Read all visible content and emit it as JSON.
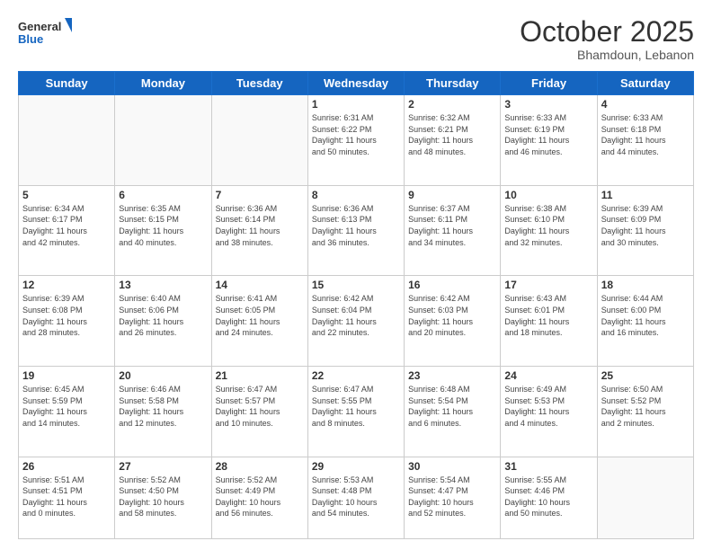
{
  "header": {
    "logo_general": "General",
    "logo_blue": "Blue",
    "month": "October 2025",
    "location": "Bhamdoun, Lebanon"
  },
  "days_of_week": [
    "Sunday",
    "Monday",
    "Tuesday",
    "Wednesday",
    "Thursday",
    "Friday",
    "Saturday"
  ],
  "weeks": [
    [
      {
        "num": "",
        "info": ""
      },
      {
        "num": "",
        "info": ""
      },
      {
        "num": "",
        "info": ""
      },
      {
        "num": "1",
        "info": "Sunrise: 6:31 AM\nSunset: 6:22 PM\nDaylight: 11 hours\nand 50 minutes."
      },
      {
        "num": "2",
        "info": "Sunrise: 6:32 AM\nSunset: 6:21 PM\nDaylight: 11 hours\nand 48 minutes."
      },
      {
        "num": "3",
        "info": "Sunrise: 6:33 AM\nSunset: 6:19 PM\nDaylight: 11 hours\nand 46 minutes."
      },
      {
        "num": "4",
        "info": "Sunrise: 6:33 AM\nSunset: 6:18 PM\nDaylight: 11 hours\nand 44 minutes."
      }
    ],
    [
      {
        "num": "5",
        "info": "Sunrise: 6:34 AM\nSunset: 6:17 PM\nDaylight: 11 hours\nand 42 minutes."
      },
      {
        "num": "6",
        "info": "Sunrise: 6:35 AM\nSunset: 6:15 PM\nDaylight: 11 hours\nand 40 minutes."
      },
      {
        "num": "7",
        "info": "Sunrise: 6:36 AM\nSunset: 6:14 PM\nDaylight: 11 hours\nand 38 minutes."
      },
      {
        "num": "8",
        "info": "Sunrise: 6:36 AM\nSunset: 6:13 PM\nDaylight: 11 hours\nand 36 minutes."
      },
      {
        "num": "9",
        "info": "Sunrise: 6:37 AM\nSunset: 6:11 PM\nDaylight: 11 hours\nand 34 minutes."
      },
      {
        "num": "10",
        "info": "Sunrise: 6:38 AM\nSunset: 6:10 PM\nDaylight: 11 hours\nand 32 minutes."
      },
      {
        "num": "11",
        "info": "Sunrise: 6:39 AM\nSunset: 6:09 PM\nDaylight: 11 hours\nand 30 minutes."
      }
    ],
    [
      {
        "num": "12",
        "info": "Sunrise: 6:39 AM\nSunset: 6:08 PM\nDaylight: 11 hours\nand 28 minutes."
      },
      {
        "num": "13",
        "info": "Sunrise: 6:40 AM\nSunset: 6:06 PM\nDaylight: 11 hours\nand 26 minutes."
      },
      {
        "num": "14",
        "info": "Sunrise: 6:41 AM\nSunset: 6:05 PM\nDaylight: 11 hours\nand 24 minutes."
      },
      {
        "num": "15",
        "info": "Sunrise: 6:42 AM\nSunset: 6:04 PM\nDaylight: 11 hours\nand 22 minutes."
      },
      {
        "num": "16",
        "info": "Sunrise: 6:42 AM\nSunset: 6:03 PM\nDaylight: 11 hours\nand 20 minutes."
      },
      {
        "num": "17",
        "info": "Sunrise: 6:43 AM\nSunset: 6:01 PM\nDaylight: 11 hours\nand 18 minutes."
      },
      {
        "num": "18",
        "info": "Sunrise: 6:44 AM\nSunset: 6:00 PM\nDaylight: 11 hours\nand 16 minutes."
      }
    ],
    [
      {
        "num": "19",
        "info": "Sunrise: 6:45 AM\nSunset: 5:59 PM\nDaylight: 11 hours\nand 14 minutes."
      },
      {
        "num": "20",
        "info": "Sunrise: 6:46 AM\nSunset: 5:58 PM\nDaylight: 11 hours\nand 12 minutes."
      },
      {
        "num": "21",
        "info": "Sunrise: 6:47 AM\nSunset: 5:57 PM\nDaylight: 11 hours\nand 10 minutes."
      },
      {
        "num": "22",
        "info": "Sunrise: 6:47 AM\nSunset: 5:55 PM\nDaylight: 11 hours\nand 8 minutes."
      },
      {
        "num": "23",
        "info": "Sunrise: 6:48 AM\nSunset: 5:54 PM\nDaylight: 11 hours\nand 6 minutes."
      },
      {
        "num": "24",
        "info": "Sunrise: 6:49 AM\nSunset: 5:53 PM\nDaylight: 11 hours\nand 4 minutes."
      },
      {
        "num": "25",
        "info": "Sunrise: 6:50 AM\nSunset: 5:52 PM\nDaylight: 11 hours\nand 2 minutes."
      }
    ],
    [
      {
        "num": "26",
        "info": "Sunrise: 5:51 AM\nSunset: 4:51 PM\nDaylight: 11 hours\nand 0 minutes."
      },
      {
        "num": "27",
        "info": "Sunrise: 5:52 AM\nSunset: 4:50 PM\nDaylight: 10 hours\nand 58 minutes."
      },
      {
        "num": "28",
        "info": "Sunrise: 5:52 AM\nSunset: 4:49 PM\nDaylight: 10 hours\nand 56 minutes."
      },
      {
        "num": "29",
        "info": "Sunrise: 5:53 AM\nSunset: 4:48 PM\nDaylight: 10 hours\nand 54 minutes."
      },
      {
        "num": "30",
        "info": "Sunrise: 5:54 AM\nSunset: 4:47 PM\nDaylight: 10 hours\nand 52 minutes."
      },
      {
        "num": "31",
        "info": "Sunrise: 5:55 AM\nSunset: 4:46 PM\nDaylight: 10 hours\nand 50 minutes."
      },
      {
        "num": "",
        "info": ""
      }
    ]
  ]
}
